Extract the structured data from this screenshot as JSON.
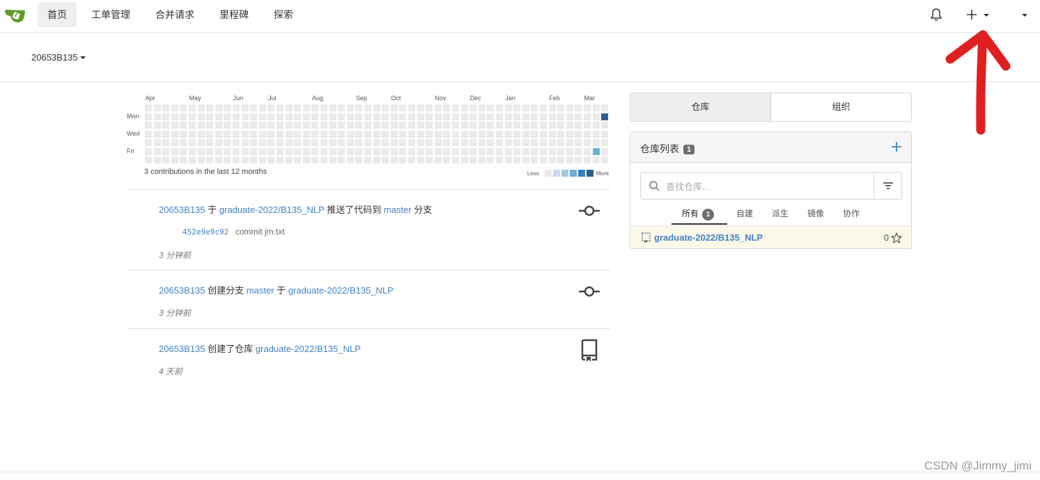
{
  "nav": {
    "items": [
      "首页",
      "工单管理",
      "合并请求",
      "里程碑",
      "探索"
    ],
    "active_index": 0
  },
  "context": {
    "user": "20653B135"
  },
  "heatmap": {
    "months": [
      "Apr",
      "May",
      "Jun",
      "Jul",
      "Aug",
      "Sep",
      "Oct",
      "Nov",
      "Dec",
      "Jan",
      "Feb",
      "Mar"
    ],
    "days": [
      "Mon",
      "Wed",
      "Fri"
    ],
    "summary": "3 contributions in the last 12 months",
    "legend_less": "Less",
    "legend_more": "More",
    "colors": {
      "empty": "#ebebeb",
      "l1": "#c6dbef",
      "l2": "#9ecae1",
      "l3": "#6baed6",
      "l4": "#3182bd",
      "l5": "#2d5f8a"
    },
    "active_cells": [
      {
        "week": 52,
        "day": 1,
        "level": 5
      },
      {
        "week": 51,
        "day": 5,
        "level": 3
      }
    ]
  },
  "feed": [
    {
      "user": "20653B135",
      "text1": "于",
      "repo": "graduate-2022/B135_NLP",
      "text2": "推送了代码到",
      "branch": "master",
      "text3": "分支",
      "commit_sha": "452e9e9c92",
      "commit_msg": "commit jm.txt",
      "time": "3 分钟前",
      "icon": "git-commit-icon"
    },
    {
      "user": "20653B135",
      "text1": "创建分支",
      "branch": "master",
      "text2": "于",
      "repo": "graduate-2022/B135_NLP",
      "time": "3 分钟前",
      "icon": "git-commit-icon"
    },
    {
      "user": "20653B135",
      "text1": "创建了仓库",
      "repo": "graduate-2022/B135_NLP",
      "time": "4 天前",
      "icon": "repo-icon"
    }
  ],
  "right": {
    "tabs": [
      "仓库",
      "组织"
    ],
    "panel_title": "仓库列表",
    "repo_count": "1",
    "search_placeholder": "查找仓库...",
    "subtabs": [
      "所有",
      "自建",
      "派生",
      "镜像",
      "协作"
    ],
    "all_count": "1",
    "repos": [
      {
        "name": "graduate-2022/B135_NLP",
        "stars": "0"
      }
    ]
  },
  "watermark": "CSDN @Jimmy_jimi",
  "annotation_color": "#e02020"
}
